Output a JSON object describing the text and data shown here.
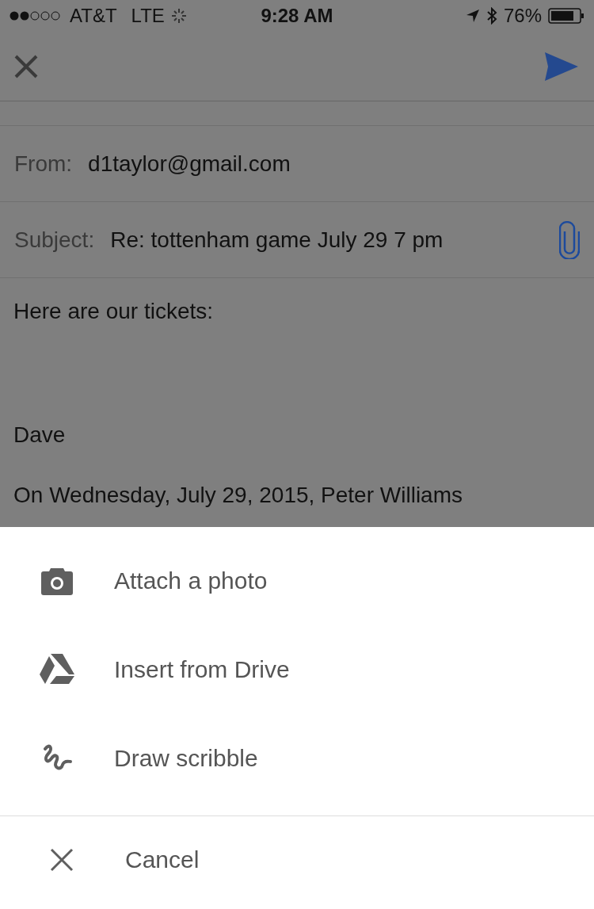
{
  "status_bar": {
    "carrier": "AT&T",
    "network": "LTE",
    "time": "9:28 AM",
    "battery": "76%"
  },
  "compose": {
    "from_label": "From:",
    "from_value": "d1taylor@gmail.com",
    "subject_label": "Subject:",
    "subject_value": "Re: tottenham game July 29 7 pm",
    "body": [
      {
        "text": "Here are our tickets:"
      },
      {
        "text": "Dave"
      },
      {
        "text": "On Wednesday, July 29, 2015, Peter Williams"
      }
    ]
  },
  "sheet": {
    "items": [
      {
        "kind": "camera",
        "label": "Attach a photo"
      },
      {
        "kind": "drive",
        "label": "Insert from Drive"
      },
      {
        "kind": "scribble",
        "label": "Draw scribble"
      }
    ],
    "cancel": {
      "kind": "close",
      "label": "Cancel"
    }
  }
}
